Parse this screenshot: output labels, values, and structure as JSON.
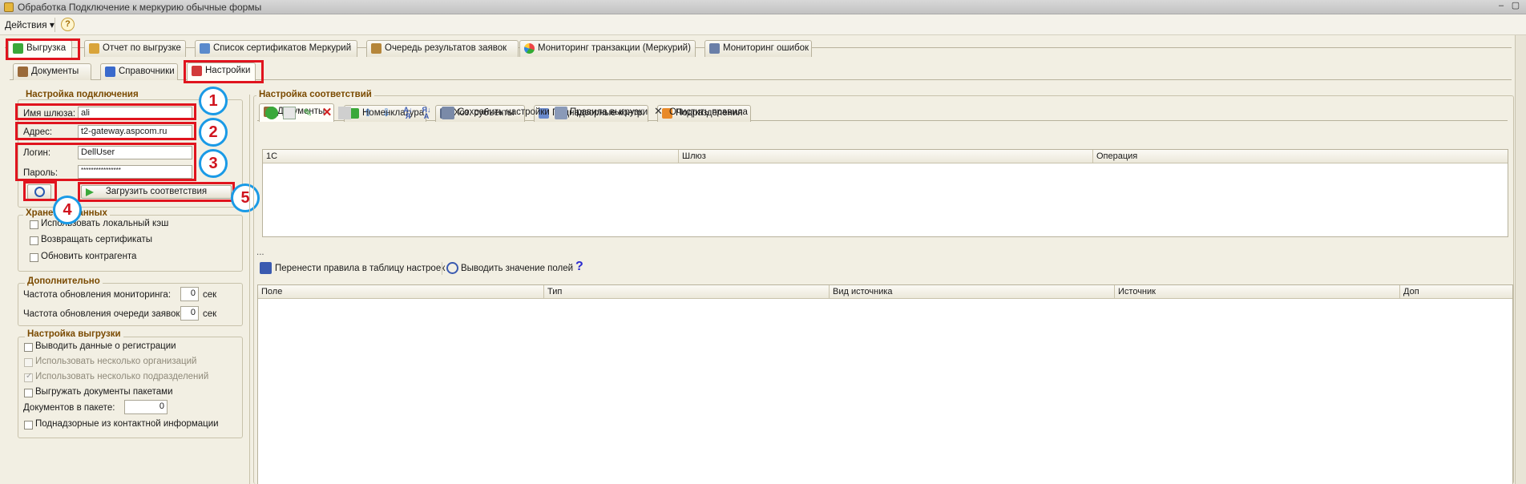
{
  "window": {
    "title": "Обработка  Подключение к меркурию обычные формы"
  },
  "menubar": {
    "actions": "Действия ▾",
    "help": "?"
  },
  "main_tabs": [
    {
      "label": "Выгрузка",
      "active": true
    },
    {
      "label": "Отчет по выгрузке"
    },
    {
      "label": "Список сертификатов Меркурий"
    },
    {
      "label": "Очередь результатов заявок"
    },
    {
      "label": "Мониторинг транзакции (Меркурий)"
    },
    {
      "label": "Мониторинг ошибок"
    }
  ],
  "sub_tabs": [
    {
      "label": "Документы"
    },
    {
      "label": "Справочники"
    },
    {
      "label": "Настройки",
      "active": true
    }
  ],
  "connection": {
    "title": "Настройка подключения",
    "gateway_label": "Имя шлюза:",
    "gateway_value": "ali",
    "address_label": "Адрес:",
    "address_value": "t2-gateway.aspcom.ru",
    "login_label": "Логин:",
    "login_value": "DellUser",
    "password_label": "Пароль:",
    "password_value": "****************",
    "load_button": "Загрузить соответствия"
  },
  "storage": {
    "title": "Хранение данных",
    "options": [
      {
        "label": "Использовать локальный кэш"
      },
      {
        "label": "Возвращать сертификаты"
      },
      {
        "label": "Обновить контрагента"
      }
    ]
  },
  "extra": {
    "title": "Дополнительно",
    "monitor_label": "Частота обновления мониторинга:",
    "monitor_value": "0",
    "queue_label": "Частота обновления очереди заявок:",
    "queue_value": "0",
    "unit": "сек"
  },
  "export": {
    "title": "Настройка выгрузки",
    "options": [
      {
        "label": "Выводить данные о регистрации"
      },
      {
        "label": "Использовать несколько организаций",
        "disabled": true
      },
      {
        "label": "Использовать несколько подразделений",
        "disabled": true,
        "checked": true
      },
      {
        "label": "Выгружать документы пакетами"
      }
    ],
    "docs_label": "Документов в пакете:",
    "docs_value": "0",
    "last_option": "Поднадзорные из контактной информации"
  },
  "mapping": {
    "title": "Настройка соответствий",
    "tabs": [
      {
        "label": "Документы",
        "active": true
      },
      {
        "label": "Номенклатура"
      },
      {
        "label": "Хоз. субъекты"
      },
      {
        "label": "Поднадзорные контр."
      },
      {
        "label": "Подразделения"
      }
    ],
    "save_settings": "Сохранить настройки",
    "export_rules": "Правила выгрузки",
    "clear_rules": "Очистить правила",
    "columns": [
      "1С",
      "Шлюз",
      "Операция"
    ],
    "ellipsis": "...",
    "transfer_rules": "Перенести правила в таблицу настроек",
    "show_fields": "Выводить значение полей",
    "help_mark": "?",
    "columns2": [
      "Поле",
      "Тип",
      "Вид источника",
      "Источник",
      "Доп"
    ]
  },
  "annotations": [
    "1",
    "2",
    "3",
    "4",
    "5"
  ]
}
